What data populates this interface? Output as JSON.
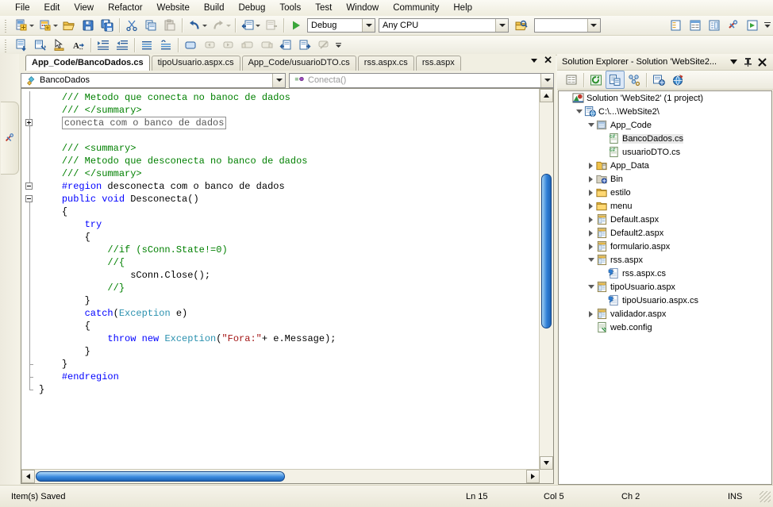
{
  "menu": {
    "items": [
      "File",
      "Edit",
      "View",
      "Refactor",
      "Website",
      "Build",
      "Debug",
      "Tools",
      "Test",
      "Window",
      "Community",
      "Help"
    ]
  },
  "toolbar": {
    "row1": [
      {
        "name": "new-item-button",
        "icon": "new-item-icon",
        "dropdown": true
      },
      {
        "name": "new-website-button",
        "icon": "new-website-icon",
        "dropdown": true
      },
      {
        "name": "open-file-button",
        "icon": "open-folder-icon",
        "dropdown": false
      },
      {
        "name": "save-button",
        "icon": "save-disk-icon",
        "dropdown": false
      },
      {
        "name": "save-all-button",
        "icon": "save-all-icon",
        "dropdown": false
      },
      {
        "name": "cut-button",
        "icon": "scissors-icon",
        "dropdown": false
      },
      {
        "name": "copy-button",
        "icon": "copy-icon",
        "dropdown": false
      },
      {
        "name": "paste-button",
        "icon": "paste-icon",
        "dropdown": false
      },
      {
        "name": "undo-button",
        "icon": "undo-arrow-icon",
        "dropdown": true
      },
      {
        "name": "redo-button",
        "icon": "redo-arrow-icon",
        "dropdown": true
      },
      {
        "name": "navigate-back-button",
        "icon": "navigate-back-icon",
        "dropdown": true
      },
      {
        "name": "navigate-forward-button",
        "icon": "navigate-forward-icon",
        "dropdown": false
      }
    ],
    "start_debug_label": "",
    "config_value": "Debug",
    "platform_value": "Any CPU",
    "find_button": "find-in-files-icon",
    "row2": [
      {
        "name": "display-database-button",
        "icon": "database-explorer-icon"
      },
      {
        "name": "properties-window-button",
        "icon": "properties-window-icon"
      },
      {
        "name": "toolbox-button",
        "icon": "toolbox-pointer-icon"
      },
      {
        "name": "find-symbol-button",
        "icon": "find-symbol-icon"
      },
      {
        "name": "increase-indent-button",
        "icon": "increase-indent-icon"
      },
      {
        "name": "decrease-indent-button",
        "icon": "decrease-indent-icon"
      },
      {
        "name": "comment-block-button",
        "icon": "comment-lines-icon"
      },
      {
        "name": "uncomment-block-button",
        "icon": "uncomment-lines-icon"
      },
      {
        "name": "toggle-bookmark-button",
        "icon": "bookmark-icon"
      },
      {
        "name": "previous-bookmark-button",
        "icon": "prev-bookmark-icon"
      },
      {
        "name": "next-bookmark-button",
        "icon": "next-bookmark-icon"
      },
      {
        "name": "prev-bookmark-folder-button",
        "icon": "prev-bookmark-folder-icon"
      },
      {
        "name": "next-bookmark-folder-button",
        "icon": "next-bookmark-folder-icon"
      },
      {
        "name": "navigate-backward-button",
        "icon": "nav-back-blue-icon"
      },
      {
        "name": "navigate-forward2-button",
        "icon": "nav-forward-blue-icon"
      },
      {
        "name": "clear-bookmarks-button",
        "icon": "clear-bookmarks-icon"
      }
    ]
  },
  "left_dock": {
    "toolbox_tab": "toolbox-icon"
  },
  "editor": {
    "tabs": [
      {
        "label": "App_Code/BancoDados.cs",
        "active": true
      },
      {
        "label": "tipoUsuario.aspx.cs",
        "active": false
      },
      {
        "label": "App_Code/usuarioDTO.cs",
        "active": false
      },
      {
        "label": "rss.aspx.cs",
        "active": false
      },
      {
        "label": "rss.aspx",
        "active": false
      }
    ],
    "class_dropdown": "BancoDados",
    "member_dropdown": "Conecta()",
    "code_lines": [
      {
        "indent": 4,
        "parts": [
          {
            "t": "/// ",
            "c": "cm"
          },
          {
            "t": "Metodo que conecta no banoc de dados",
            "c": "cm"
          }
        ]
      },
      {
        "indent": 4,
        "parts": [
          {
            "t": "/// </summary>",
            "c": "cm"
          }
        ]
      },
      {
        "indent": 4,
        "parts": [
          {
            "t": "conecta com o banco de dados",
            "c": "collapsed"
          }
        ]
      },
      {
        "indent": 0,
        "parts": []
      },
      {
        "indent": 4,
        "parts": [
          {
            "t": "/// <summary>",
            "c": "cm"
          }
        ]
      },
      {
        "indent": 4,
        "parts": [
          {
            "t": "/// ",
            "c": "cm"
          },
          {
            "t": "Metodo que desconecta no banco de dados",
            "c": "cm"
          }
        ]
      },
      {
        "indent": 4,
        "parts": [
          {
            "t": "/// </summary>",
            "c": "cm"
          }
        ]
      },
      {
        "indent": 4,
        "parts": [
          {
            "t": "#region",
            "c": "pp"
          },
          {
            "t": " desconecta com o banco de dados",
            "c": ""
          }
        ]
      },
      {
        "indent": 4,
        "parts": [
          {
            "t": "public void",
            "c": "kw"
          },
          {
            "t": " Desconecta()",
            "c": ""
          }
        ]
      },
      {
        "indent": 4,
        "parts": [
          {
            "t": "{",
            "c": ""
          }
        ]
      },
      {
        "indent": 8,
        "parts": [
          {
            "t": "try",
            "c": "kw"
          }
        ]
      },
      {
        "indent": 8,
        "parts": [
          {
            "t": "{",
            "c": ""
          }
        ]
      },
      {
        "indent": 12,
        "parts": [
          {
            "t": "//if (sConn.State!=0)",
            "c": "cm"
          }
        ]
      },
      {
        "indent": 12,
        "parts": [
          {
            "t": "//{",
            "c": "cm"
          }
        ]
      },
      {
        "indent": 16,
        "parts": [
          {
            "t": "sConn.Close();",
            "c": ""
          }
        ]
      },
      {
        "indent": 12,
        "parts": [
          {
            "t": "//}",
            "c": "cm"
          }
        ]
      },
      {
        "indent": 8,
        "parts": [
          {
            "t": "}",
            "c": ""
          }
        ]
      },
      {
        "indent": 8,
        "parts": [
          {
            "t": "catch",
            "c": "kw"
          },
          {
            "t": "(",
            "c": ""
          },
          {
            "t": "Exception",
            "c": "ty"
          },
          {
            "t": " e)",
            "c": ""
          }
        ]
      },
      {
        "indent": 8,
        "parts": [
          {
            "t": "{",
            "c": ""
          }
        ]
      },
      {
        "indent": 12,
        "parts": [
          {
            "t": "throw new",
            "c": "kw"
          },
          {
            "t": " ",
            "c": ""
          },
          {
            "t": "Exception",
            "c": "ty"
          },
          {
            "t": "(",
            "c": ""
          },
          {
            "t": "\"Fora:\"",
            "c": "st"
          },
          {
            "t": "+ e.Message);",
            "c": ""
          }
        ]
      },
      {
        "indent": 8,
        "parts": [
          {
            "t": "}",
            "c": ""
          }
        ]
      },
      {
        "indent": 4,
        "parts": [
          {
            "t": "}",
            "c": ""
          }
        ]
      },
      {
        "indent": 4,
        "parts": [
          {
            "t": "#endregion",
            "c": "pp"
          }
        ]
      },
      {
        "indent": 0,
        "parts": [
          {
            "t": "}",
            "c": ""
          }
        ]
      }
    ]
  },
  "solution_explorer": {
    "title": "Solution Explorer - Solution 'WebSite2...",
    "toolbar": [
      {
        "name": "properties-button",
        "icon": "properties-icon",
        "active": false
      },
      {
        "name": "refresh-button",
        "icon": "refresh-icon",
        "active": false
      },
      {
        "name": "view-code-button",
        "icon": "view-code-icon",
        "active": true
      },
      {
        "name": "nest-related-files-button",
        "icon": "nest-files-icon",
        "active": false
      },
      {
        "name": "copy-website-button",
        "icon": "copy-website-icon",
        "active": false
      },
      {
        "name": "aspnet-configuration-button",
        "icon": "aspnet-config-icon",
        "active": false
      }
    ],
    "tree": [
      {
        "depth": 0,
        "label": "Solution 'WebSite2' (1 project)",
        "icon": "solution-icon",
        "expander": "none",
        "selected": false
      },
      {
        "depth": 1,
        "label": "C:\\...\\WebSite2\\",
        "icon": "website-project-icon",
        "expander": "expanded",
        "selected": false
      },
      {
        "depth": 2,
        "label": "App_Code",
        "icon": "special-folder-icon",
        "expander": "expanded",
        "selected": false
      },
      {
        "depth": 3,
        "label": "BancoDados.cs",
        "icon": "csharp-file-icon",
        "expander": "none",
        "selected": true
      },
      {
        "depth": 3,
        "label": "usuarioDTO.cs",
        "icon": "csharp-file-icon",
        "expander": "none",
        "selected": false
      },
      {
        "depth": 2,
        "label": "App_Data",
        "icon": "data-folder-icon",
        "expander": "collapsed",
        "selected": false
      },
      {
        "depth": 2,
        "label": "Bin",
        "icon": "bin-folder-icon",
        "expander": "collapsed",
        "selected": false
      },
      {
        "depth": 2,
        "label": "estilo",
        "icon": "folder-icon",
        "expander": "collapsed",
        "selected": false
      },
      {
        "depth": 2,
        "label": "menu",
        "icon": "folder-icon",
        "expander": "collapsed",
        "selected": false
      },
      {
        "depth": 2,
        "label": "Default.aspx",
        "icon": "aspx-file-icon",
        "expander": "collapsed",
        "selected": false
      },
      {
        "depth": 2,
        "label": "Default2.aspx",
        "icon": "aspx-file-icon",
        "expander": "collapsed",
        "selected": false
      },
      {
        "depth": 2,
        "label": "formulario.aspx",
        "icon": "aspx-file-icon",
        "expander": "collapsed",
        "selected": false
      },
      {
        "depth": 2,
        "label": "rss.aspx",
        "icon": "aspx-file-icon",
        "expander": "expanded",
        "selected": false
      },
      {
        "depth": 3,
        "label": "rss.aspx.cs",
        "icon": "codebehind-file-icon",
        "expander": "none",
        "selected": false
      },
      {
        "depth": 2,
        "label": "tipoUsuario.aspx",
        "icon": "aspx-file-icon",
        "expander": "expanded",
        "selected": false
      },
      {
        "depth": 3,
        "label": "tipoUsuario.aspx.cs",
        "icon": "codebehind-file-icon",
        "expander": "none",
        "selected": false
      },
      {
        "depth": 2,
        "label": "validador.aspx",
        "icon": "aspx-file-icon",
        "expander": "collapsed",
        "selected": false
      },
      {
        "depth": 2,
        "label": "web.config",
        "icon": "config-file-icon",
        "expander": "none",
        "selected": false
      }
    ]
  },
  "status": {
    "message": "Item(s) Saved",
    "line": "Ln 15",
    "col": "Col 5",
    "ch": "Ch 2",
    "insert_mode": "INS"
  },
  "colors": {
    "accent_blue": "#2f7fd6",
    "keyword": "#0000ff",
    "comment": "#008000",
    "type": "#2b91af",
    "string": "#a31515",
    "chrome": "#f1efe2"
  }
}
